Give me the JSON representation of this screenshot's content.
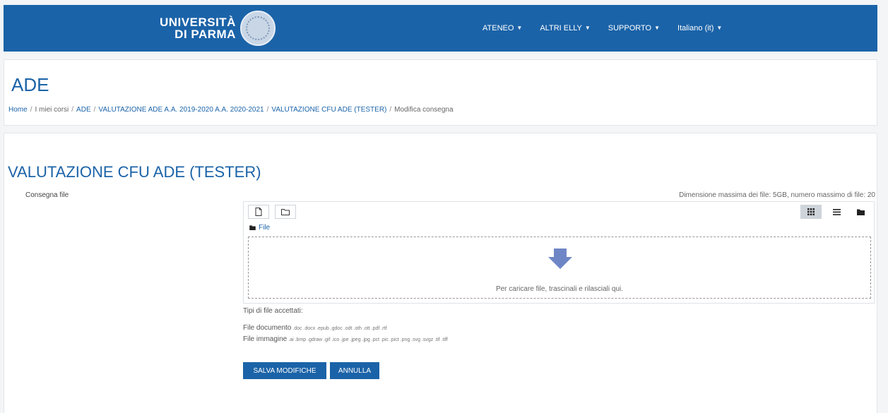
{
  "brand": {
    "line1": "UNIVERSITÀ",
    "line2": "DI PARMA",
    "primary_color": "#1b63a8"
  },
  "nav": [
    {
      "label": "ATENEO"
    },
    {
      "label": "ALTRI ELLY"
    },
    {
      "label": "SUPPORTO"
    },
    {
      "label": "Italiano (it)"
    }
  ],
  "header": {
    "title": "ADE",
    "breadcrumb": [
      "Home",
      "I miei corsi",
      "ADE",
      "VALUTAZIONE ADE A.A. 2019-2020 A.A. 2020-2021",
      "VALUTAZIONE CFU ADE (TESTER)",
      "Modifica consegna"
    ]
  },
  "main": {
    "title": "VALUTAZIONE CFU ADE (TESTER)",
    "field_label": "Consegna file",
    "max_info": "Dimensione massima dei file: 5GB, numero massimo di file: 20",
    "filepicker": {
      "path_label": "File",
      "drop_text": "Per caricare file, trascinali e rilasciali qui."
    },
    "accepted_title": "Tipi di file accettati:",
    "file_types": [
      {
        "label": "File documento",
        "exts": ".doc .docx .epub .gdoc .odt .oth .ott .pdf .rtf"
      },
      {
        "label": "File immagine",
        "exts": ".ai .bmp .gdraw .gif .ico .jpe .jpeg .jpg .pct .pic .pict .png .svg .svgz .tif .tiff"
      }
    ],
    "buttons": {
      "save": "SALVA MODIFICHE",
      "cancel": "ANNULLA"
    }
  }
}
